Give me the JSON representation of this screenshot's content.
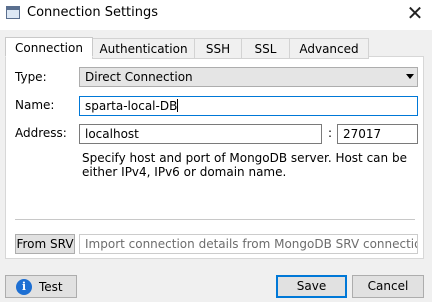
{
  "window": {
    "title": "Connection Settings",
    "close_glyph": "✕"
  },
  "tabs": [
    {
      "label": "Connection",
      "active": true
    },
    {
      "label": "Authentication"
    },
    {
      "label": "SSH"
    },
    {
      "label": "SSL"
    },
    {
      "label": "Advanced"
    }
  ],
  "form": {
    "type_label": "Type:",
    "type_value": "Direct Connection",
    "name_label": "Name:",
    "name_value": "sparta-local-DB",
    "address_label": "Address:",
    "host_value": "localhost",
    "port_separator": ":",
    "port_value": "27017",
    "hint": "Specify host and port of MongoDB server. Host can be either IPv4, IPv6 or domain name."
  },
  "srv": {
    "button_label": "From SRV",
    "placeholder": "Import connection details from MongoDB SRV connectio···"
  },
  "footer": {
    "info_glyph": "i",
    "test_label": "Test",
    "save_label": "Save",
    "cancel_label": "Cancel"
  },
  "colors": {
    "accent": "#0078d7",
    "info": "#1d6fd3"
  }
}
